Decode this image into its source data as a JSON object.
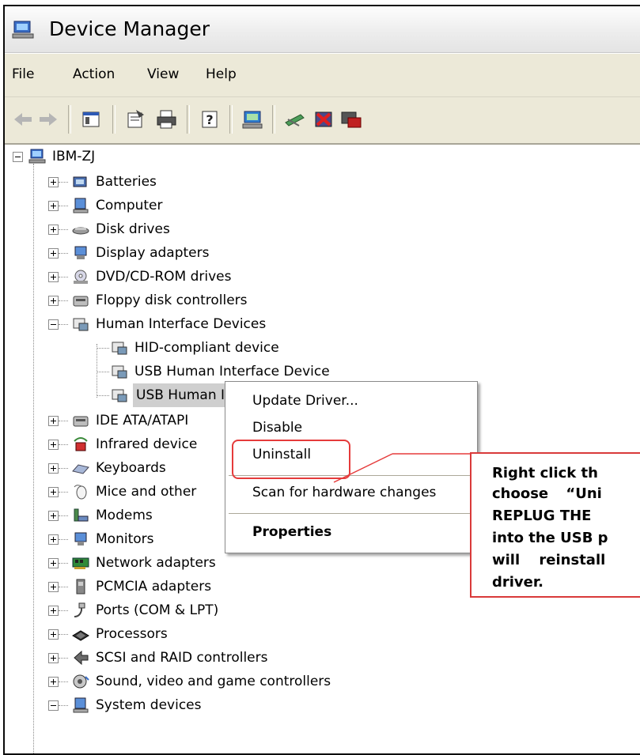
{
  "window": {
    "title": "Device Manager"
  },
  "menu": [
    "File",
    "Action",
    "View",
    "Help"
  ],
  "toolbar_icons": [
    "back-arrow-icon",
    "forward-arrow-icon",
    "show-hide-console-tree-icon",
    "properties-icon",
    "print-icon",
    "help-icon",
    "scan-hardware-icon",
    "update-driver-icon",
    "uninstall-icon",
    "disable-icon"
  ],
  "tree": {
    "root": "IBM-ZJ",
    "categories": [
      {
        "label": "Batteries",
        "icon": "battery-icon"
      },
      {
        "label": "Computer",
        "icon": "computer-icon"
      },
      {
        "label": "Disk drives",
        "icon": "disk-drive-icon"
      },
      {
        "label": "Display adapters",
        "icon": "display-adapter-icon"
      },
      {
        "label": "DVD/CD-ROM drives",
        "icon": "dvd-drive-icon"
      },
      {
        "label": "Floppy disk controllers",
        "icon": "floppy-controller-icon"
      },
      {
        "label": "Human Interface Devices",
        "icon": "hid-icon"
      },
      {
        "label": "IDE ATA/ATAPI",
        "icon": "ide-controller-icon"
      },
      {
        "label": "Infrared device",
        "icon": "infrared-icon"
      },
      {
        "label": "Keyboards",
        "icon": "keyboard-icon"
      },
      {
        "label": "Mice and other",
        "icon": "mouse-icon"
      },
      {
        "label": "Modems",
        "icon": "modem-icon"
      },
      {
        "label": "Monitors",
        "icon": "monitor-icon"
      },
      {
        "label": "Network adapters",
        "icon": "network-adapter-icon"
      },
      {
        "label": "PCMCIA adapters",
        "icon": "pcmcia-icon"
      },
      {
        "label": "Ports (COM & LPT)",
        "icon": "ports-icon"
      },
      {
        "label": "Processors",
        "icon": "processor-icon"
      },
      {
        "label": "SCSI and RAID controllers",
        "icon": "scsi-icon"
      },
      {
        "label": "Sound, video and game controllers",
        "icon": "sound-icon"
      },
      {
        "label": "System devices",
        "icon": "system-devices-icon"
      }
    ],
    "hid_children": [
      "HID-compliant device",
      "USB Human Interface Device",
      "USB Human Interface Device"
    ]
  },
  "context_menu": {
    "items": [
      "Update Driver...",
      "Disable",
      "Uninstall",
      "Scan for hardware changes",
      "Properties"
    ]
  },
  "callout": {
    "lines": [
      "Right click th",
      "choose “Uni",
      "REPLUG THE",
      "into the USB p",
      "will reinstall",
      "driver."
    ]
  },
  "colors": {
    "annotation_red": "#e53b3b",
    "menu_bg": "#ece9d8",
    "selection": "#cfcfcf"
  }
}
